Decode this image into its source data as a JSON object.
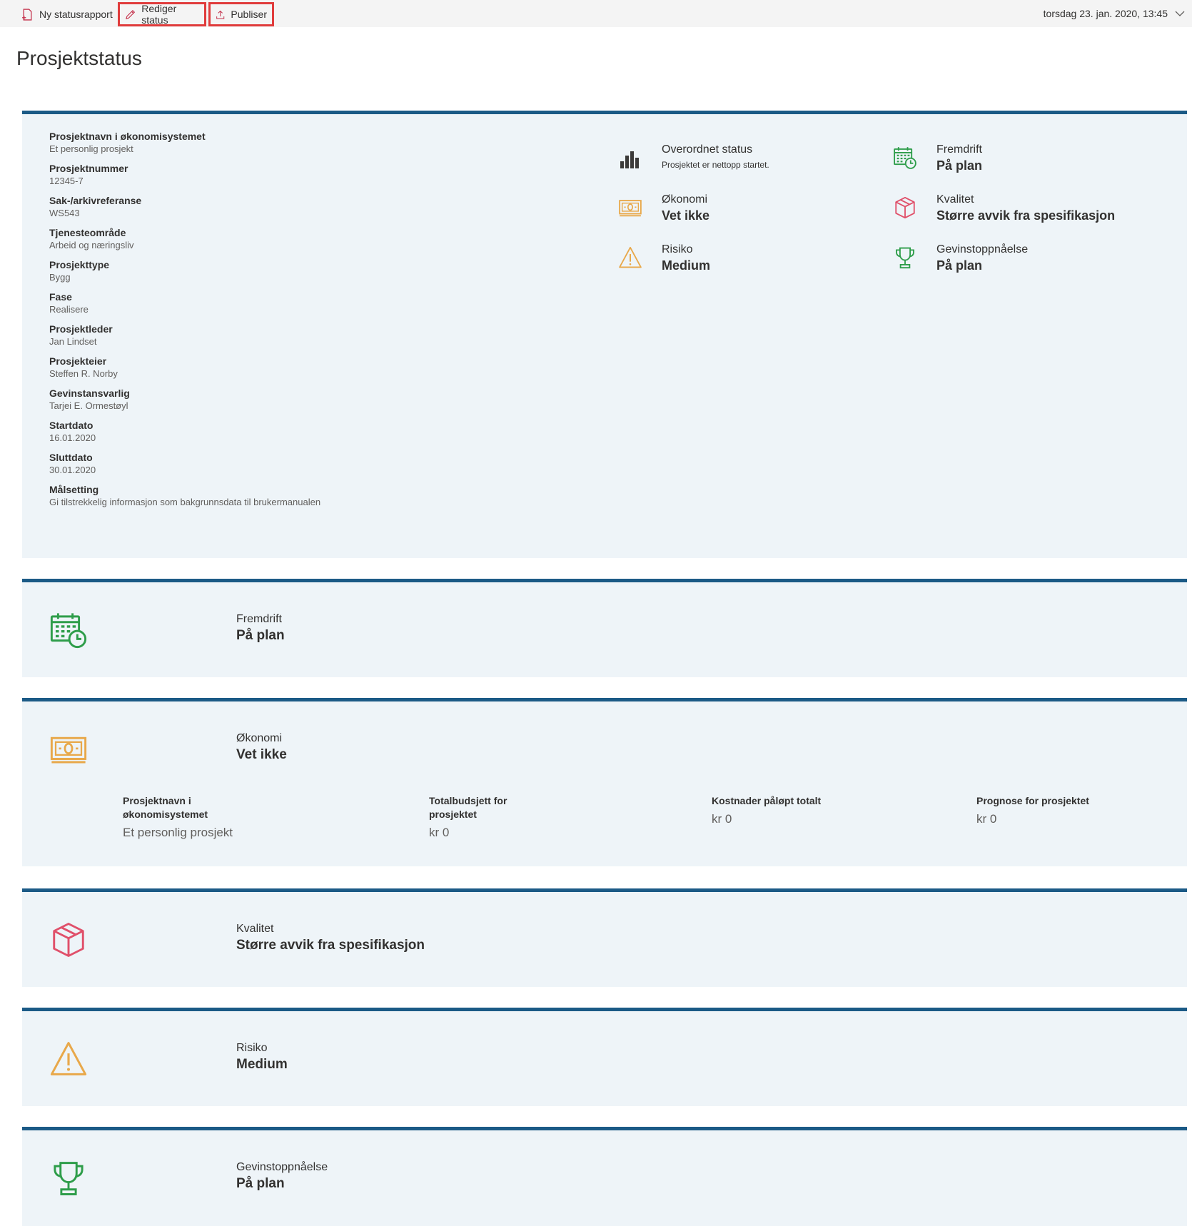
{
  "toolbar": {
    "new_report": "Ny statusrapport",
    "edit_status": "Rediger status",
    "publish": "Publiser",
    "report_date": "torsdag 23. jan. 2020, 13:45"
  },
  "page": {
    "title": "Prosjektstatus"
  },
  "colors": {
    "accent": "#1b5a86",
    "green": "#2e9d4a",
    "orange": "#e8a84a",
    "red": "#e0506a",
    "section_bg": "#eef4f8",
    "highlight": "#e03c3c"
  },
  "fields": [
    {
      "label": "Prosjektnavn i økonomisystemet",
      "value": "Et personlig prosjekt"
    },
    {
      "label": "Prosjektnummer",
      "value": "12345-7"
    },
    {
      "label": "Sak-/arkivreferanse",
      "value": "WS543"
    },
    {
      "label": "Tjenesteområde",
      "value": "Arbeid og næringsliv"
    },
    {
      "label": "Prosjekttype",
      "value": "Bygg"
    },
    {
      "label": "Fase",
      "value": "Realisere"
    },
    {
      "label": "Prosjektleder",
      "value": "Jan Lindset"
    },
    {
      "label": "Prosjekteier",
      "value": "Steffen R. Norby"
    },
    {
      "label": "Gevinstansvarlig",
      "value": "Tarjei E. Ormestøyl"
    },
    {
      "label": "Startdato",
      "value": "16.01.2020"
    },
    {
      "label": "Sluttdato",
      "value": "30.01.2020"
    },
    {
      "label": "Målsetting",
      "value": "Gi tilstrekkelig informasjon som bakgrunnsdata til brukermanualen"
    }
  ],
  "summary": {
    "overall": {
      "title": "Overordnet status",
      "value": "Prosjektet er nettopp startet.",
      "icon": "bar-chart-icon"
    },
    "progress": {
      "title": "Fremdrift",
      "value": "På plan",
      "icon": "calendar-clock-icon"
    },
    "economy": {
      "title": "Økonomi",
      "value": "Vet ikke",
      "icon": "money-icon"
    },
    "quality": {
      "title": "Kvalitet",
      "value": "Større avvik fra spesifikasjon",
      "icon": "box-icon"
    },
    "risk": {
      "title": "Risiko",
      "value": "Medium",
      "icon": "warning-icon"
    },
    "benefit": {
      "title": "Gevinstoppnåelse",
      "value": "På plan",
      "icon": "trophy-icon"
    }
  },
  "sections": {
    "progress": {
      "title": "Fremdrift",
      "value": "På plan"
    },
    "economy": {
      "title": "Økonomi",
      "value": "Vet ikke",
      "columns": [
        {
          "label": "Prosjektnavn i økonomisystemet",
          "value": "Et personlig prosjekt"
        },
        {
          "label": "Totalbudsjett for prosjektet",
          "value": "kr 0"
        },
        {
          "label": "Kostnader påløpt totalt",
          "value": "kr 0"
        },
        {
          "label": "Prognose for prosjektet",
          "value": "kr 0"
        }
      ]
    },
    "quality": {
      "title": "Kvalitet",
      "value": "Større avvik fra spesifikasjon"
    },
    "risk": {
      "title": "Risiko",
      "value": "Medium"
    },
    "benefit": {
      "title": "Gevinstoppnåelse",
      "value": "På plan"
    }
  }
}
